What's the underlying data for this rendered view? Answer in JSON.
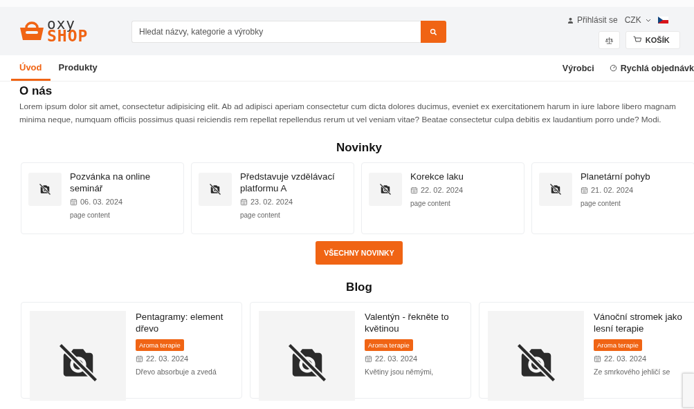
{
  "header": {
    "logo": {
      "top": "oxy",
      "bottom": "SHOP"
    },
    "search": {
      "placeholder": "Hledat názvy, kategorie a výrobky"
    },
    "login": "Přihlásit se",
    "currency": "CZK",
    "cart": "KOŠÍK"
  },
  "nav": {
    "left": [
      {
        "label": "Úvod",
        "selected": true
      },
      {
        "label": "Produkty",
        "selected": false
      }
    ],
    "right": [
      {
        "label": "Výrobci",
        "kind": "plain"
      },
      {
        "label": "Rychlá objednávk",
        "kind": "gauge"
      }
    ]
  },
  "about": {
    "title": "O nás",
    "text": "Lorem ipsum dolor sit amet, consectetur adipisicing elit. Ab ad adipisci aperiam consectetur cum dicta dolores ducimus, eveniet ex exercitationem harum in iure labore libero magnam minima neque, numquam officiis possimus quasi reiciendis rem repellat repellendus rerum ut vel veniam vitae? Beatae consectetur culpa debitis ex laudantium porro unde? Modi."
  },
  "news": {
    "title": "Novinky",
    "items": [
      {
        "title": "Pozvánka na online seminář",
        "date": "06. 03. 2024",
        "text": "page content"
      },
      {
        "title": "Představuje vzdělávací platformu A",
        "date": "23. 02. 2024",
        "text": "page content"
      },
      {
        "title": "Korekce laku",
        "date": "22. 02. 2024",
        "text": "page content"
      },
      {
        "title": "Planetární pohyb",
        "date": "21. 02. 2024",
        "text": "page content"
      }
    ],
    "button": "VŠECHNY NOVINKY"
  },
  "blog": {
    "title": "Blog",
    "items": [
      {
        "title": "Pentagramy: element dřevo",
        "tag": "Aroma terapie",
        "date": "22. 03. 2024",
        "text": "Dřevo absorbuje a zvedá"
      },
      {
        "title": "Valentýn - řekněte to květinou",
        "tag": "Aroma terapie",
        "date": "22. 03. 2024",
        "text": "Květiny jsou němými,"
      },
      {
        "title": "Vánoční stromek jako lesní terapie",
        "tag": "Aroma terapie",
        "date": "22. 03. 2024",
        "text": "Ze smrkového jehličí se"
      }
    ]
  }
}
